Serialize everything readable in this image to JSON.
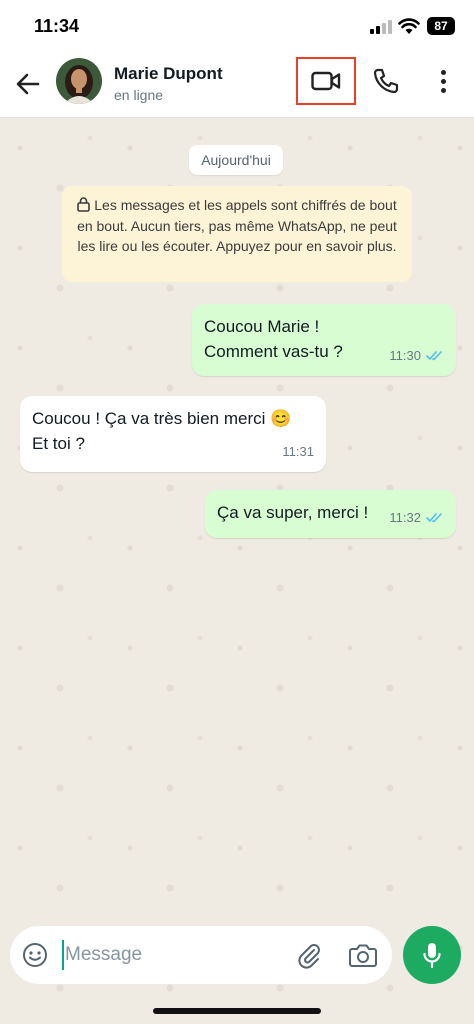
{
  "status_bar": {
    "time": "11:34",
    "battery": "87"
  },
  "header": {
    "contact_name": "Marie Dupont",
    "contact_status": "en ligne"
  },
  "chat": {
    "date_label": "Aujourd'hui",
    "encryption_notice": "Les messages et les appels sont chiffrés de bout en bout. Aucun tiers, pas même WhatsApp, ne peut les lire ou les écouter. Appuyez pour en savoir plus.",
    "messages": [
      {
        "direction": "outgoing",
        "text": "Coucou Marie !\nComment vas-tu ?",
        "time": "11:30",
        "status": "read"
      },
      {
        "direction": "incoming",
        "text": "Coucou ! Ça va très bien merci 😊\nEt toi ?",
        "time": "11:31"
      },
      {
        "direction": "outgoing",
        "text": "Ça va super, merci !",
        "time": "11:32",
        "status": "read"
      }
    ]
  },
  "composer": {
    "placeholder": "Message"
  },
  "colors": {
    "accent_green": "#1daa61",
    "read_tick_blue": "#53bdeb",
    "outgoing_bubble": "#d9fdd3",
    "highlight_box": "#e8402a"
  }
}
